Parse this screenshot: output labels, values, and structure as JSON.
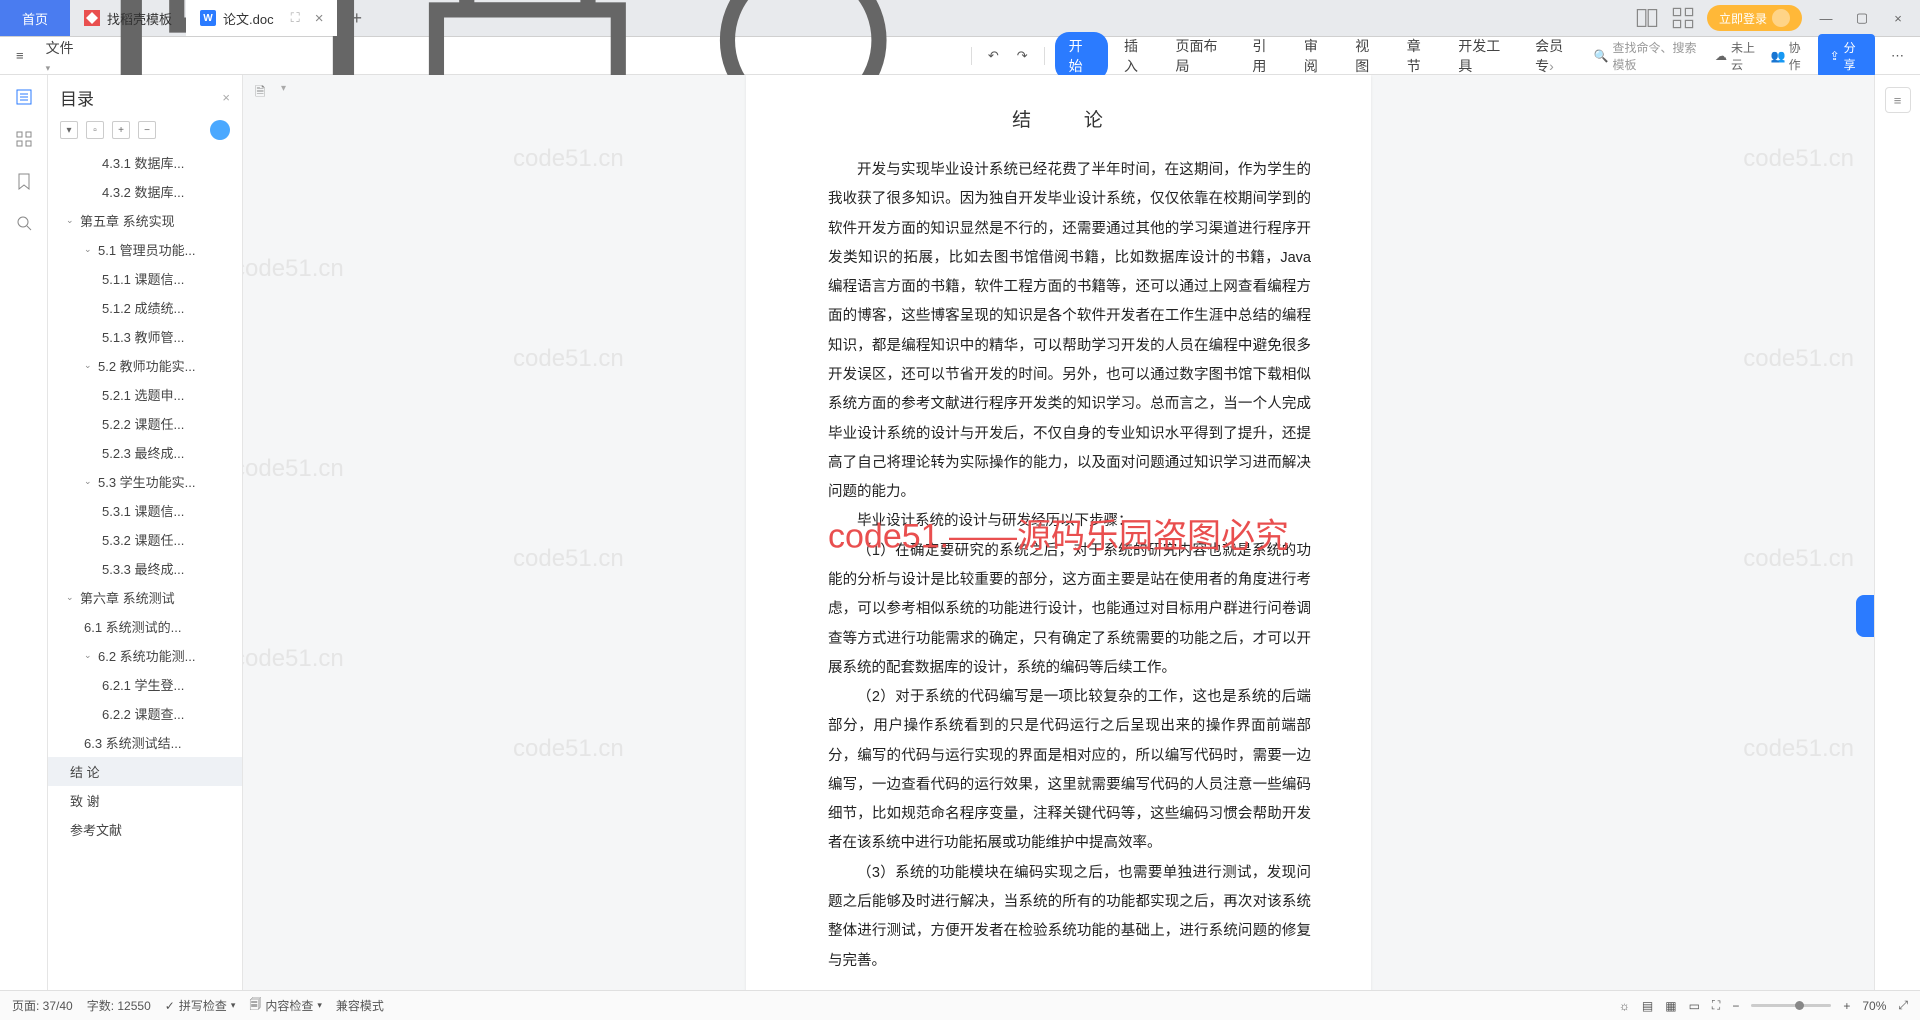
{
  "tabs": {
    "home": "首页",
    "template": "找稻壳模板",
    "doc": "论文.doc"
  },
  "login_label": "立即登录",
  "file_label": "文件",
  "menus": [
    "开始",
    "插入",
    "页面布局",
    "引用",
    "审阅",
    "视图",
    "章节",
    "开发工具",
    "会员专"
  ],
  "search_placeholder": "查找命令、搜索模板",
  "cloud_status": "未上云",
  "collab": "协作",
  "share": "分享",
  "outline": {
    "title": "目录",
    "items": [
      {
        "lvl": 3,
        "text": "4.3.1 数据库..."
      },
      {
        "lvl": 3,
        "text": "4.3.2 数据库..."
      },
      {
        "lvl": 1,
        "text": "第五章 系统实现",
        "caret": true
      },
      {
        "lvl": 2,
        "text": "5.1 管理员功能...",
        "caret": true
      },
      {
        "lvl": 3,
        "text": "5.1.1 课题信..."
      },
      {
        "lvl": 3,
        "text": "5.1.2 成绩统..."
      },
      {
        "lvl": 3,
        "text": "5.1.3 教师管..."
      },
      {
        "lvl": 2,
        "text": "5.2 教师功能实...",
        "caret": true
      },
      {
        "lvl": 3,
        "text": "5.2.1 选题申..."
      },
      {
        "lvl": 3,
        "text": "5.2.2 课题任..."
      },
      {
        "lvl": 3,
        "text": "5.2.3 最终成..."
      },
      {
        "lvl": 2,
        "text": "5.3 学生功能实...",
        "caret": true
      },
      {
        "lvl": 3,
        "text": "5.3.1 课题信..."
      },
      {
        "lvl": 3,
        "text": "5.3.2 课题任..."
      },
      {
        "lvl": 3,
        "text": "5.3.3 最终成..."
      },
      {
        "lvl": 1,
        "text": "第六章 系统测试",
        "caret": true
      },
      {
        "lvl": 2,
        "text": "6.1 系统测试的..."
      },
      {
        "lvl": 2,
        "text": "6.2 系统功能测...",
        "caret": true
      },
      {
        "lvl": 3,
        "text": "6.2.1 学生登..."
      },
      {
        "lvl": 3,
        "text": "6.2.2 课题查..."
      },
      {
        "lvl": 2,
        "text": "6.3 系统测试结..."
      },
      {
        "lvl": 0,
        "text": "结  论",
        "selected": true
      },
      {
        "lvl": 0,
        "text": "致  谢"
      },
      {
        "lvl": 0,
        "text": "参考文献"
      }
    ]
  },
  "document": {
    "title": "结  论",
    "p1": "开发与实现毕业设计系统已经花费了半年时间，在这期间，作为学生的我收获了很多知识。因为独自开发毕业设计系统，仅仅依靠在校期间学到的软件开发方面的知识显然是不行的，还需要通过其他的学习渠道进行程序开发类知识的拓展，比如去图书馆借阅书籍，比如数据库设计的书籍，Java 编程语言方面的书籍，软件工程方面的书籍等，还可以通过上网查看编程方面的博客，这些博客呈现的知识是各个软件开发者在工作生涯中总结的编程知识，都是编程知识中的精华，可以帮助学习开发的人员在编程中避免很多开发误区，还可以节省开发的时间。另外，也可以通过数字图书馆下载相似系统方面的参考文献进行程序开发类的知识学习。总而言之，当一个人完成毕业设计系统的设计与开发后，不仅自身的专业知识水平得到了提升，还提高了自己将理论转为实际操作的能力，以及面对问题通过知识学习进而解决问题的能力。",
    "p2": "毕业设计系统的设计与研发经历以下步骤：",
    "p3": "（1）在确定要研究的系统之后，对于系统的研究内容也就是系统的功能的分析与设计是比较重要的部分，这方面主要是站在使用者的角度进行考虑，可以参考相似系统的功能进行设计，也能通过对目标用户群进行问卷调查等方式进行功能需求的确定，只有确定了系统需要的功能之后，才可以开展系统的配套数据库的设计，系统的编码等后续工作。",
    "p4": "（2）对于系统的代码编写是一项比较复杂的工作，这也是系统的后端部分，用户操作系统看到的只是代码运行之后呈现出来的操作界面前端部分，编写的代码与运行实现的界面是相对应的，所以编写代码时，需要一边编写，一边查看代码的运行效果，这里就需要编写代码的人员注意一些编码细节，比如规范命名程序变量，注释关键代码等，这些编码习惯会帮助开发者在该系统中进行功能拓展或功能维护中提高效率。",
    "p5": "（3）系统的功能模块在编码实现之后，也需要单独进行测试，发现问题之后能够及时进行解决，当系统的所有的功能都实现之后，再次对该系统整体进行测试，方便开发者在检验系统功能的基础上，进行系统问题的修复与完善。"
  },
  "watermark_center": "code51.——源码乐园盗图必究",
  "watermark_bg": "code51.cn",
  "status": {
    "page": "页面: 37/40",
    "words": "字数: 12550",
    "spell": "拼写检查",
    "content": "内容检查",
    "compat": "兼容模式",
    "zoom": "70%"
  }
}
